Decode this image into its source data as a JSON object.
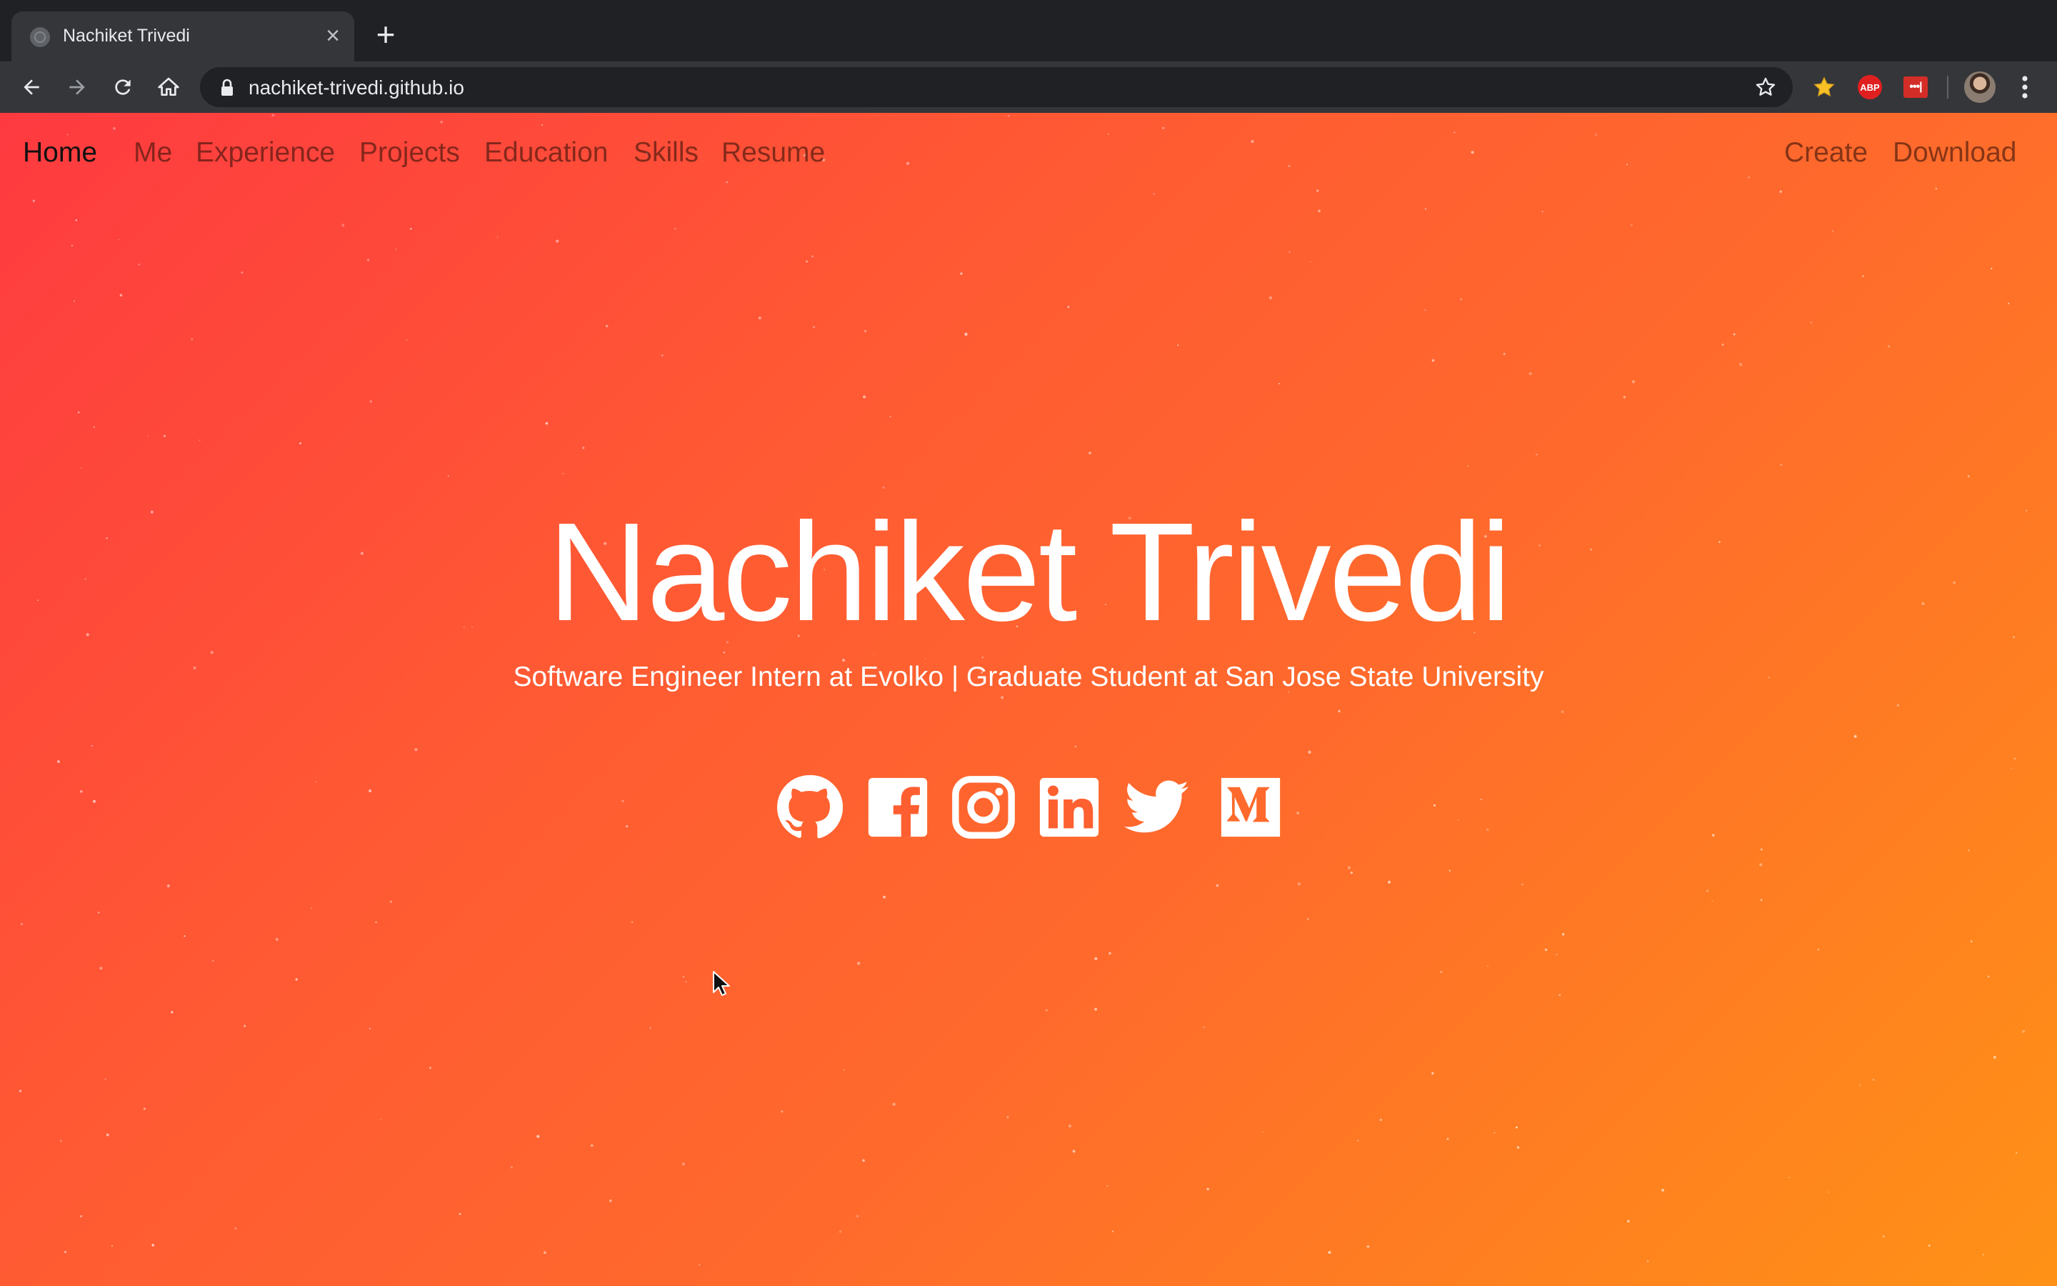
{
  "browser": {
    "tab_title": "Nachiket Trivedi",
    "tab_close": "×",
    "new_tab": "+",
    "url": "nachiket-trivedi.github.io",
    "extensions": [
      {
        "name": "favorites-extension-icon"
      },
      {
        "name": "adblock-icon",
        "label": "ABP"
      },
      {
        "name": "lastpass-icon",
        "label": "•••|"
      }
    ]
  },
  "nav": {
    "brand": "Home",
    "items": [
      "Me",
      "Experience",
      "Projects",
      "Education",
      "Skills",
      "Resume"
    ],
    "right_items": [
      "Create",
      "Download"
    ]
  },
  "hero": {
    "title": "Nachiket Trivedi",
    "subtitle": "Software Engineer Intern at Evolko | Graduate Student at San Jose State University"
  },
  "socials": [
    {
      "name": "github-icon"
    },
    {
      "name": "facebook-icon"
    },
    {
      "name": "instagram-icon"
    },
    {
      "name": "linkedin-icon"
    },
    {
      "name": "twitter-icon"
    },
    {
      "name": "medium-icon"
    }
  ],
  "colors": {
    "gradient_start": "#fe3a40",
    "gradient_end": "#ff9216",
    "chrome_dark": "#202124",
    "chrome_toolbar": "#35363a"
  }
}
